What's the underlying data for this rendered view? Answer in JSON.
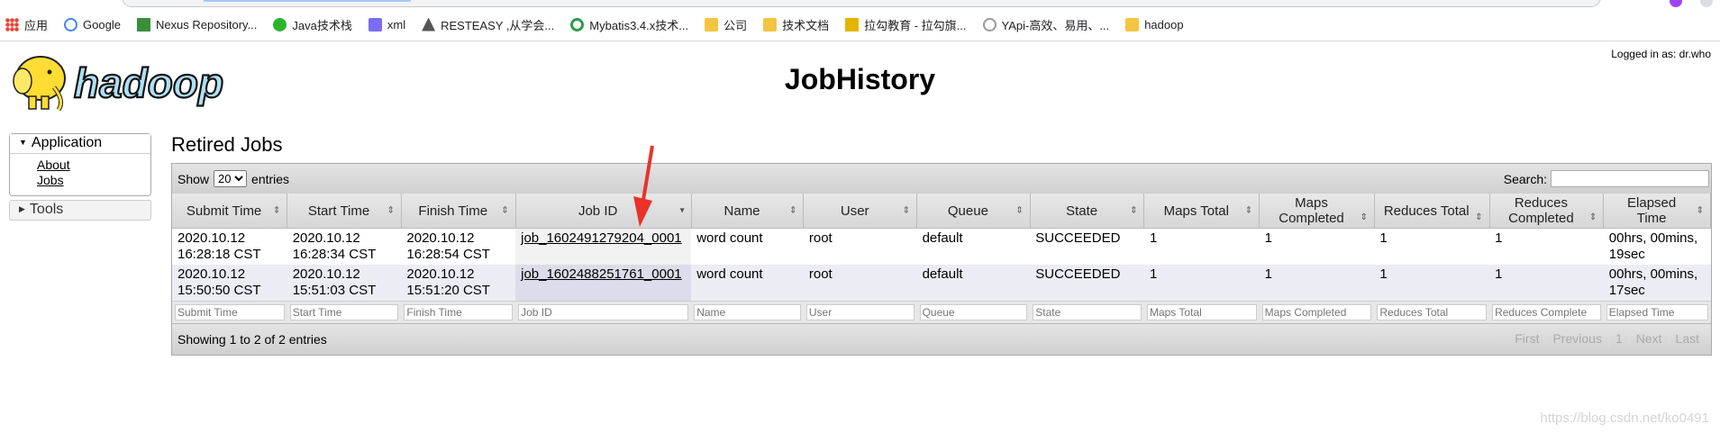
{
  "bookmarks": [
    {
      "label": "应用",
      "icon": "apps-grid-icon"
    },
    {
      "label": "Google",
      "icon": "google-icon"
    },
    {
      "label": "Nexus Repository...",
      "icon": "nexus-icon"
    },
    {
      "label": "Java技术栈",
      "icon": "wechat-icon"
    },
    {
      "label": "xml",
      "icon": "xml-icon"
    },
    {
      "label": "RESTEASY ,从学会...",
      "icon": "resteasy-icon"
    },
    {
      "label": "Mybatis3.4.x技术...",
      "icon": "mybatis-icon"
    },
    {
      "label": "公司",
      "icon": "folder-icon"
    },
    {
      "label": "技术文档",
      "icon": "folder-icon"
    },
    {
      "label": "拉勾教育 - 拉勾旗...",
      "icon": "lagou-icon"
    },
    {
      "label": "YApi-高效、易用、...",
      "icon": "yapi-icon"
    },
    {
      "label": "hadoop",
      "icon": "folder-icon"
    }
  ],
  "header": {
    "logged_in": "Logged in as: dr.who",
    "title": "JobHistory",
    "logo_text": "hadoop"
  },
  "nav": {
    "application_label": "Application",
    "links": [
      "About",
      "Jobs"
    ],
    "tools_label": "Tools"
  },
  "main": {
    "section_title": "Retired Jobs",
    "show_label": "Show",
    "entries_value": "20",
    "entries_label": "entries",
    "search_label": "Search:",
    "columns": [
      "Submit Time",
      "Start Time",
      "Finish Time",
      "Job ID",
      "Name",
      "User",
      "Queue",
      "State",
      "Maps Total",
      "Maps Completed",
      "Reduces Total",
      "Reduces Completed",
      "Elapsed Time"
    ],
    "rows": [
      [
        "2020.10.12 16:28:18 CST",
        "2020.10.12 16:28:34 CST",
        "2020.10.12 16:28:54 CST",
        "job_1602491279204_0001",
        "word count",
        "root",
        "default",
        "SUCCEEDED",
        "1",
        "1",
        "1",
        "1",
        "00hrs, 00mins, 19sec"
      ],
      [
        "2020.10.12 15:50:50 CST",
        "2020.10.12 15:51:03 CST",
        "2020.10.12 15:51:20 CST",
        "job_1602488251761_0001",
        "word count",
        "root",
        "default",
        "SUCCEEDED",
        "1",
        "1",
        "1",
        "1",
        "00hrs, 00mins, 17sec"
      ]
    ],
    "filter_placeholders": [
      "Submit Time",
      "Start Time",
      "Finish Time",
      "Job ID",
      "Name",
      "User",
      "Queue",
      "State",
      "Maps Total",
      "Maps Completed",
      "Reduces Total",
      "Reduces Complete",
      "Elapsed Time"
    ],
    "info": "Showing 1 to 2 of 2 entries",
    "pager": [
      "First",
      "Previous",
      "1",
      "Next",
      "Last"
    ]
  },
  "watermark": "https://blog.csdn.net/ko0491",
  "colors": {
    "annotation_arrow": "#e8322b",
    "logo_yellow": "#ffdd33",
    "logo_blue": "#aee0f5"
  }
}
